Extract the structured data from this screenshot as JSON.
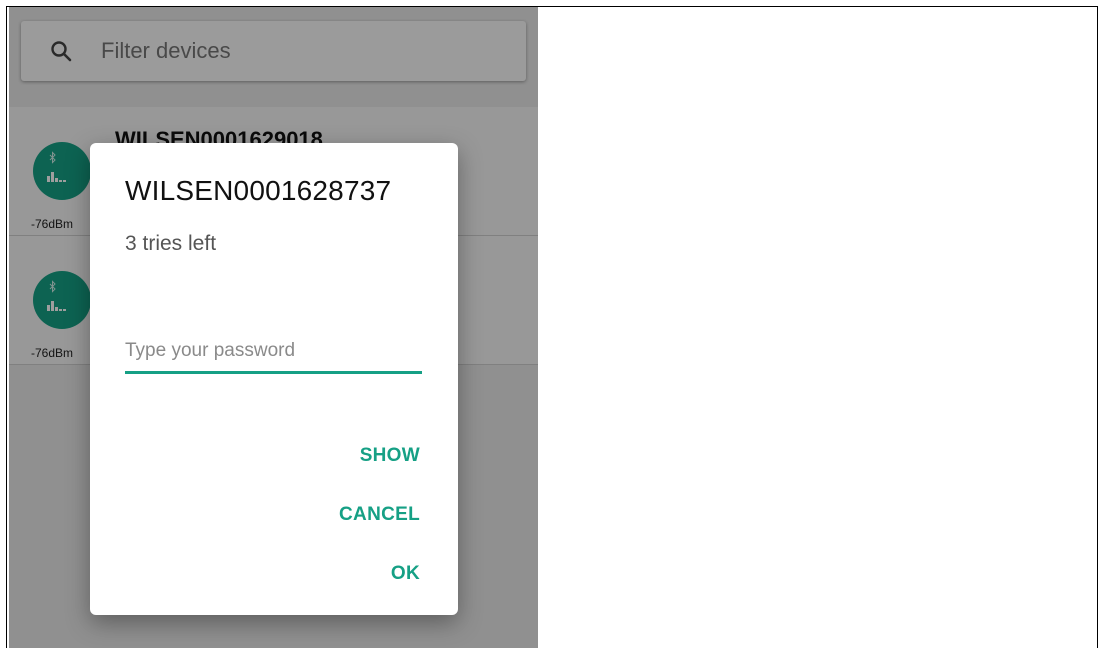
{
  "search": {
    "placeholder": "Filter devices",
    "value": ""
  },
  "devices": [
    {
      "name": "WILSEN0001629018",
      "rssi": "-76dBm"
    },
    {
      "name": "",
      "rssi": "-76dBm"
    }
  ],
  "dialog": {
    "title": "WILSEN0001628737",
    "subtitle": "3 tries left",
    "password_placeholder": "Type your password",
    "password_value": "",
    "show_label": "SHOW",
    "cancel_label": "CANCEL",
    "ok_label": "OK"
  },
  "colors": {
    "accent": "#16a085",
    "scrim": "rgba(0,0,0,0.38)"
  },
  "icons": {
    "search": "search-icon",
    "device": "bluetooth-signal-icon"
  }
}
